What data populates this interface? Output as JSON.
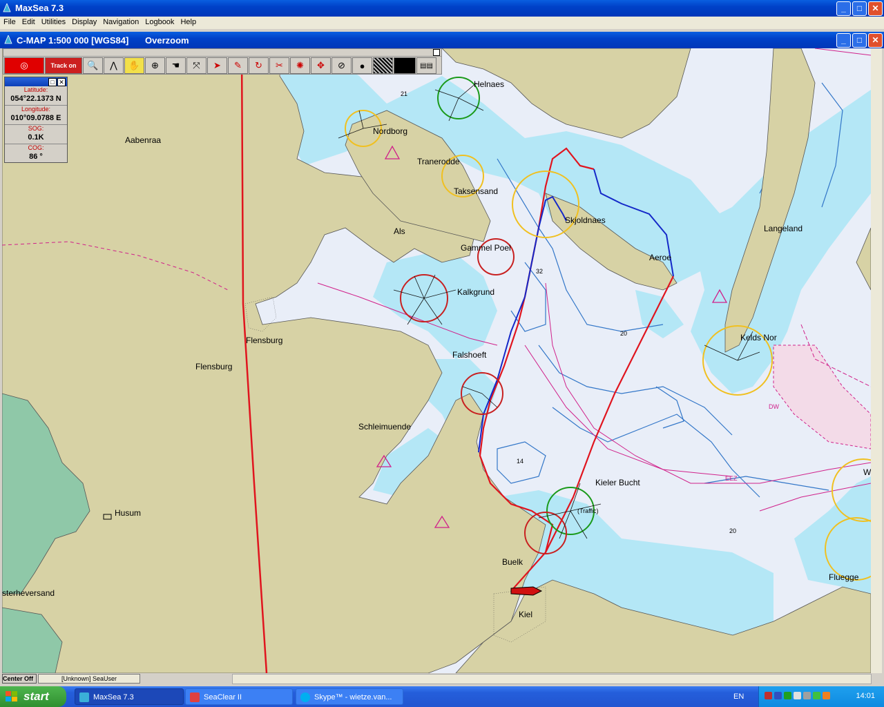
{
  "app": {
    "title": "MaxSea 7.3"
  },
  "menu": [
    "File",
    "Edit",
    "Utilities",
    "Display",
    "Navigation",
    "Logbook",
    "Help"
  ],
  "chart_window": {
    "title": "C-MAP  1:500 000 [WGS84]",
    "mode": "Overzoom"
  },
  "toolbar": {
    "track_label": "Track on"
  },
  "info": {
    "lat_label": "Latitude:",
    "lat_value": "054°22.1373 N",
    "lon_label": "Longitude:",
    "lon_value": "010°09.0788 E",
    "sog_label": "SOG:",
    "sog_value": "0.1K",
    "cog_label": "COG:",
    "cog_value": "86 °"
  },
  "places": {
    "helnaes": "Helnaes",
    "nordborg": "Nordborg",
    "tranerodde": "Tranerodde",
    "taksensand": "Taksensand",
    "skjoldnaes": "Skjoldnaes",
    "langeland": "Langeland",
    "aabenraa": "Aabenraa",
    "als": "Als",
    "gammel_poel": "Gammel Poel",
    "aeroe": "Aeroe",
    "kalkgrund": "Kalkgrund",
    "keldsnor": "Kelds Nor",
    "flensburg_a": "Flensburg",
    "flensburg_b": "Flensburg",
    "falshoeft": "Falshoeft",
    "schleimuende": "Schleimuende",
    "kieler_bucht": "Kieler Bucht",
    "traffic": "(Traffic)",
    "husum": "Husum",
    "buelk": "Buelk",
    "kiel": "Kiel",
    "fluegge": "Fluegge",
    "westerheversand": "sterheversand",
    "w": "W"
  },
  "soundings": {
    "s21": "21",
    "s32": "32",
    "s14": "14",
    "s20a": "20",
    "s20b": "20"
  },
  "chart_marks": {
    "eez": "EEZ",
    "dw": "DW"
  },
  "status": {
    "center_btn": "Center Off",
    "user": "[Unknown] SeaUser"
  },
  "taskbar": {
    "start": "start",
    "tasks": [
      "MaxSea 7.3",
      "SeaClear II",
      "Skype™ - wietze.van..."
    ],
    "lang": "EN",
    "clock": "14:01"
  },
  "colors": {
    "land": "#d7d2a5",
    "shallow": "#b2e6f5",
    "deep": "#eaf0fa",
    "track_red": "#e0141e",
    "track_blue": "#1428c8"
  }
}
